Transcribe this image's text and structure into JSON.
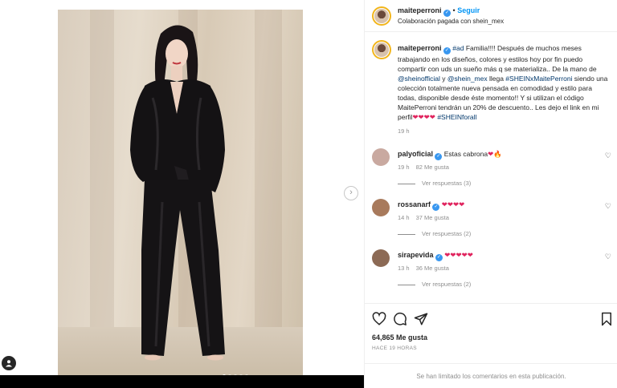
{
  "post": {
    "username": "maiteperroni",
    "follow_label": "Seguir",
    "collab_text": "Colaboración pagada con shein_mex",
    "carousel_dots": 5,
    "active_dot": 0
  },
  "caption": {
    "username": "maiteperroni",
    "parts": [
      {
        "t": "#ad",
        "k": "tag"
      },
      {
        "t": " Familia!!!! Después de muchos meses trabajando en los diseños, colores y estilos hoy por fin puedo compartir con uds un sueño más q se materializa.. De la mano de ",
        "k": "txt"
      },
      {
        "t": "@sheinofficial",
        "k": "tag"
      },
      {
        "t": " y ",
        "k": "txt"
      },
      {
        "t": "@shein_mex",
        "k": "tag"
      },
      {
        "t": " llega ",
        "k": "txt"
      },
      {
        "t": "#SHEINxMaitePerroni",
        "k": "tag"
      },
      {
        "t": " siendo una colección totalmente nueva pensada en comodidad y estilo para todas, disponible desde éste momento!! Y si utilizan el código MaitePerroni tendrán un 20% de descuento.. Les dejo el link en mi perfil",
        "k": "txt"
      },
      {
        "t": "❤❤❤❤",
        "k": "heart"
      },
      {
        "t": " ",
        "k": "txt"
      },
      {
        "t": "#SHEINforall",
        "k": "tag"
      }
    ],
    "time": "19 h"
  },
  "comments": [
    {
      "username": "palyoficial",
      "verified": true,
      "text": "Estas cabrona",
      "emoji": "❤🔥",
      "time": "19 h",
      "likes": "82 Me gusta",
      "replies": "Ver respuestas (3)",
      "avatar_color": "#c9a9a0"
    },
    {
      "username": "rossanarf",
      "verified": true,
      "text": "",
      "emoji": "❤❤❤❤",
      "time": "14 h",
      "likes": "37 Me gusta",
      "replies": "Ver respuestas (2)",
      "avatar_color": "#a87a5c"
    },
    {
      "username": "sirapevida",
      "verified": true,
      "text": "",
      "emoji": "❤❤❤❤❤",
      "time": "13 h",
      "likes": "36 Me gusta",
      "replies": "Ver respuestas (2)",
      "avatar_color": "#8c6a55"
    }
  ],
  "footer": {
    "likes": "64,865 Me gusta",
    "ago": "HACE 19 HORAS",
    "limited": "Se han limitado los comentarios en esta publicación."
  },
  "icons": {
    "like": "heart-icon",
    "comment": "comment-icon",
    "share": "share-icon",
    "save": "bookmark-icon",
    "next": "chevron-right-icon",
    "tags": "user-tag-icon"
  },
  "colors": {
    "link": "#00376b",
    "follow": "#0095f6",
    "verified": "#3897f0",
    "heart": "#e0245e"
  }
}
